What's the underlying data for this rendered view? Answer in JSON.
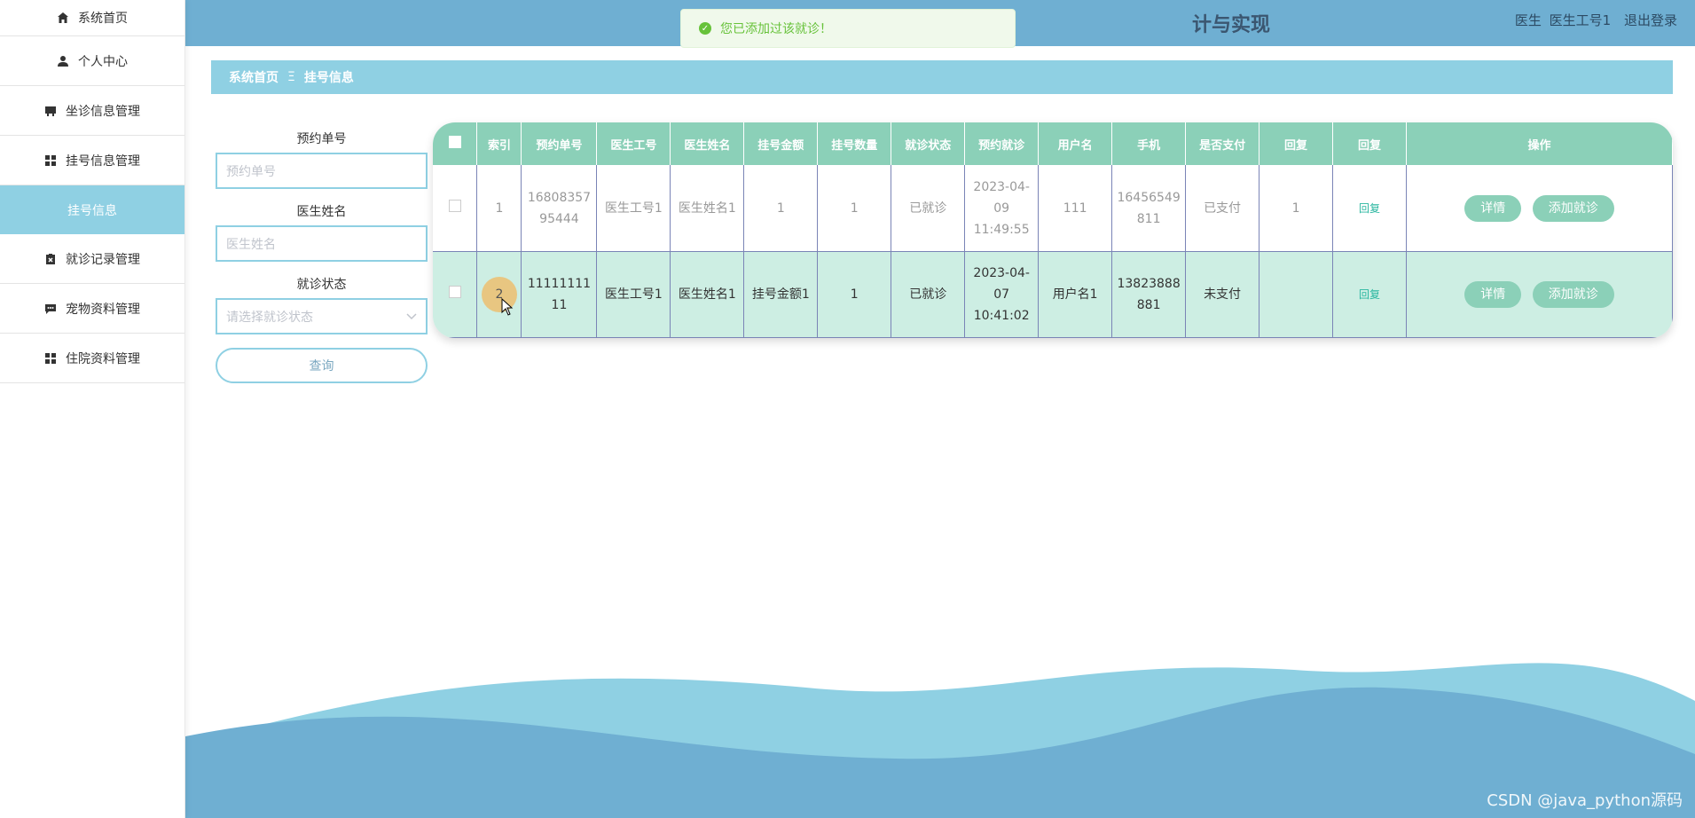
{
  "sidebar": {
    "items": [
      {
        "label": "系统首页",
        "icon": "home-icon"
      },
      {
        "label": "个人中心",
        "icon": "user-icon"
      },
      {
        "label": "坐诊信息管理",
        "icon": "clinic-icon"
      },
      {
        "label": "挂号信息管理",
        "icon": "grid-icon"
      },
      {
        "label": "挂号信息",
        "icon": ""
      },
      {
        "label": "就诊记录管理",
        "icon": "clipboard-icon"
      },
      {
        "label": "宠物资料管理",
        "icon": "message-icon"
      },
      {
        "label": "住院资料管理",
        "icon": "grid-icon"
      }
    ]
  },
  "header": {
    "title": "计与实现",
    "user_role": "医生",
    "user_name": "医生工号1",
    "logout": "退出登录"
  },
  "toast": {
    "message": "您已添加过该就诊！"
  },
  "breadcrumb": {
    "home": "系统首页",
    "separator": "Ξ",
    "current": "挂号信息"
  },
  "search": {
    "order_label": "预约单号",
    "order_placeholder": "预约单号",
    "doctor_label": "医生姓名",
    "doctor_placeholder": "医生姓名",
    "status_label": "就诊状态",
    "status_placeholder": "请选择就诊状态",
    "query_button": "查询"
  },
  "table": {
    "headers": [
      "索引",
      "预约单号",
      "医生工号",
      "医生姓名",
      "挂号金额",
      "挂号数量",
      "就诊状态",
      "预约就诊",
      "用户名",
      "手机",
      "是否支付",
      "回复",
      "回复",
      "操作"
    ],
    "rows": [
      {
        "index": "1",
        "order_no": "1680835795444",
        "doctor_id": "医生工号1",
        "doctor_name": "医生姓名1",
        "amount": "1",
        "quantity": "1",
        "status": "已就诊",
        "appointment": "2023-04-09 11:49:55",
        "username": "111",
        "phone": "16456549811",
        "paid": "已支付",
        "reply": "1",
        "reply_link": "回复",
        "detail": "详情",
        "add": "添加就诊"
      },
      {
        "index": "2",
        "order_no": "1111111111",
        "doctor_id": "医生工号1",
        "doctor_name": "医生姓名1",
        "amount": "挂号金额1",
        "quantity": "1",
        "status": "已就诊",
        "appointment": "2023-04-07 10:41:02",
        "username": "用户名1",
        "phone": "13823888881",
        "paid": "未支付",
        "reply": "",
        "reply_link": "回复",
        "detail": "详情",
        "add": "添加就诊"
      }
    ]
  },
  "watermark": "CSDN @java_python源码",
  "colors": {
    "sky": "#8fd0e3",
    "header": "#6fafd2",
    "mint": "#8bd0b8",
    "row_highlight": "#cdeee3",
    "success": "#67c23a"
  }
}
